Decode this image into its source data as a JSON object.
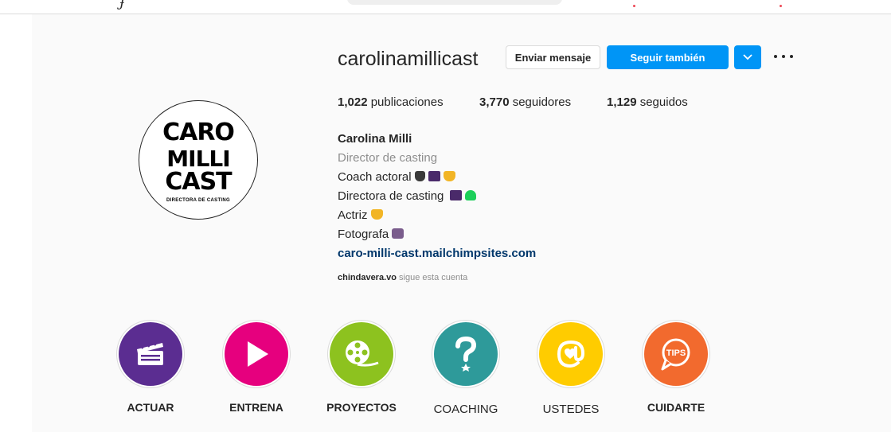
{
  "profile": {
    "username": "carolinamillicast",
    "message_label": "Enviar mensaje",
    "follow_label": "Seguir también",
    "stats": [
      {
        "count": "1,022",
        "label": "publicaciones"
      },
      {
        "count": "3,770",
        "label": "seguidores"
      },
      {
        "count": "1,129",
        "label": "seguidos"
      }
    ],
    "display_name": "Carolina Milli",
    "category": "Director de casting",
    "bio_lines": [
      "Coach actoral",
      "Directora de casting",
      "Actriz",
      "Fotografa"
    ],
    "link": "caro-milli-cast.mailchimpsites.com",
    "followed_by_user": "chindavera.vo",
    "followed_by_text": "sigue esta cuenta"
  },
  "avatar": {
    "line1": "CARO",
    "line2": "MILLI",
    "line3": "CAST",
    "subtitle": "DIRECTORA DE CASTING"
  },
  "highlights": [
    {
      "label": "ACTUAR",
      "color": "#5b2d91",
      "icon": "clapperboard-icon"
    },
    {
      "label": "ENTRENA",
      "color": "#e6007e",
      "icon": "play-icon"
    },
    {
      "label": "PROYECTOS",
      "color": "#8dc21f",
      "icon": "film-reel-icon"
    },
    {
      "label": "COACHING",
      "color": "#2e9a9a",
      "icon": "question-mark-icon"
    },
    {
      "label": "USTEDES",
      "color": "#ffcc00",
      "icon": "at-sign-icon"
    },
    {
      "label": "CUIDARTE",
      "color": "#f26a2e",
      "icon": "tips-bubble-icon",
      "badge": "TIPS"
    }
  ],
  "colors": {
    "accent": "#0095f6",
    "link": "#00376b",
    "muted": "#8e8e8e"
  }
}
